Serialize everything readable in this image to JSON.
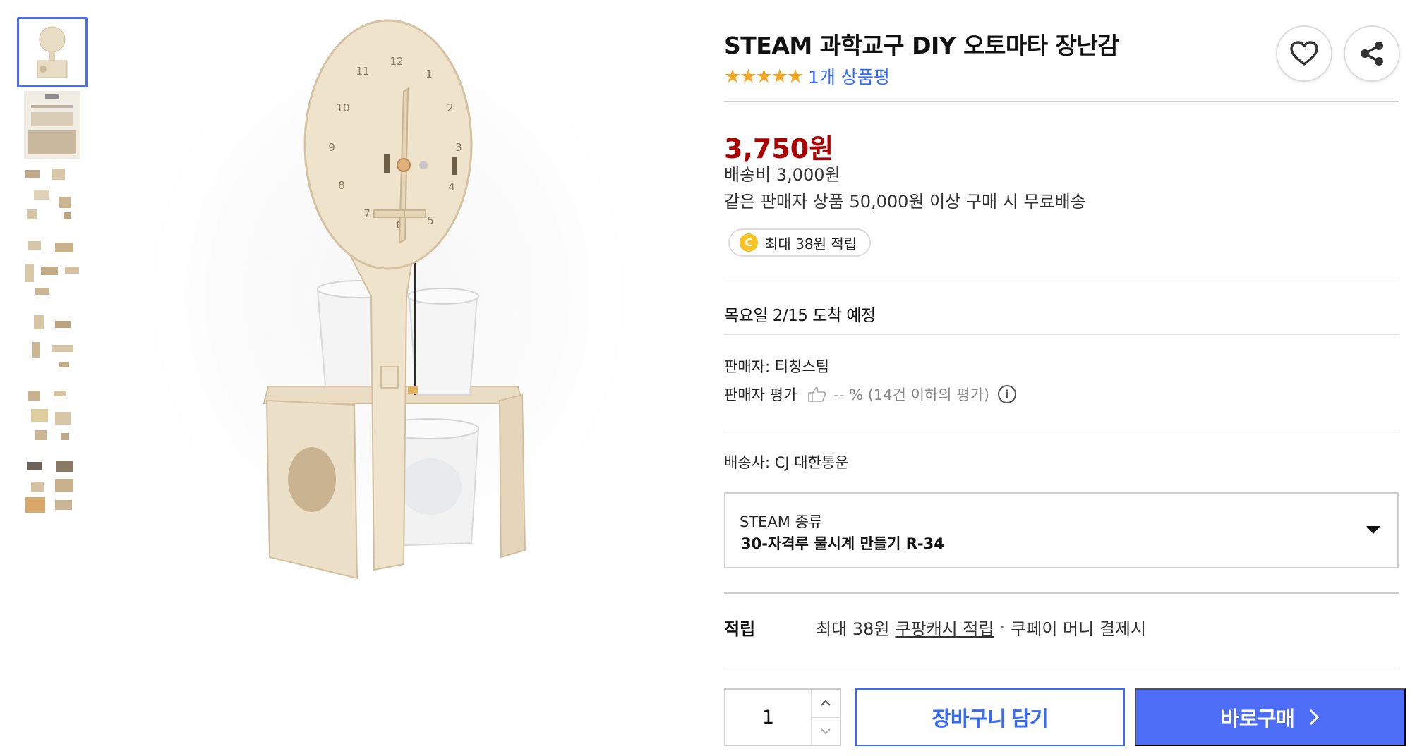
{
  "product": {
    "title": "STEAM 과학교구 DIY 오토마타 장난감",
    "stars": "★★★★★",
    "review_count": "1개 상품평",
    "rating": 5
  },
  "price": {
    "amount": "3,750원",
    "shipping_fee": "배송비 3,000원",
    "free_shipping": "같은 판매자 상품 50,000원 이상 구매 시 무료배송"
  },
  "cash_badge": {
    "coin": "C",
    "text": "최대 38원 적립"
  },
  "delivery": {
    "arrival": "목요일 2/15 도착 예정"
  },
  "seller": {
    "name": "판매자: 티칭스팀",
    "rating_label": "판매자 평가",
    "rating_value": "-- % (14건 이하의 평가)",
    "info_icon": "i"
  },
  "courier": "배송사: CJ 대한통운",
  "option": {
    "label": "STEAM 종류",
    "value": "30-자격루 물시계 만들기 R-34"
  },
  "points": {
    "label": "적립",
    "prefix": "최대 38원",
    "link": "쿠팡캐시 적립",
    "dot": "·",
    "suffix": "쿠페이 머니 결제시"
  },
  "purchase": {
    "quantity": "1",
    "cart_label": "장바구니 담기",
    "buy_label": "바로구매"
  },
  "clock_numbers": [
    "12",
    "1",
    "2",
    "3",
    "4",
    "5",
    "6",
    "7",
    "8",
    "9",
    "10",
    "11"
  ],
  "icons": {
    "wishlist": "heart-icon",
    "share": "share-icon",
    "qty_up": "chevron-up-icon",
    "qty_down": "chevron-down-icon",
    "option_caret": "caret-down-icon",
    "buy_chevron": "chevron-right-icon",
    "seller_thumb": "thumbs-up-icon"
  },
  "colors": {
    "accent": "#346aff",
    "buy_button": "#4f6ef7",
    "price": "#ae0000",
    "stars": "#f5a623",
    "coin": "#f7c325",
    "thumb_active_border": "#4a6cf7"
  }
}
